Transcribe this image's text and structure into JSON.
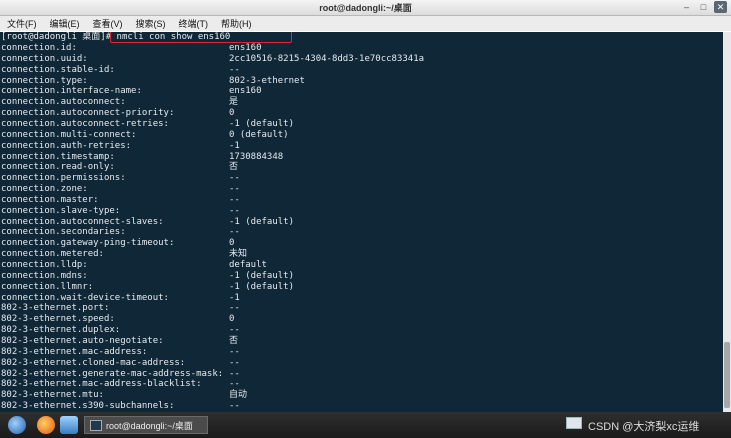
{
  "window": {
    "title": "root@dadongli:~/桌面"
  },
  "menu": [
    "文件(F)",
    "编辑(E)",
    "查看(V)",
    "搜索(S)",
    "终端(T)",
    "帮助(H)"
  ],
  "terminal": {
    "prompt": "[root@dadongli 桌面]# ",
    "command": "nmcli con show ens160",
    "rows": [
      {
        "key": "connection.id:",
        "val": "ens160"
      },
      {
        "key": "connection.uuid:",
        "val": "2cc10516-8215-4304-8dd3-1e70cc83341a"
      },
      {
        "key": "connection.stable-id:",
        "val": "--"
      },
      {
        "key": "connection.type:",
        "val": "802-3-ethernet"
      },
      {
        "key": "connection.interface-name:",
        "val": "ens160"
      },
      {
        "key": "connection.autoconnect:",
        "val": "是"
      },
      {
        "key": "connection.autoconnect-priority:",
        "val": "0"
      },
      {
        "key": "connection.autoconnect-retries:",
        "val": "-1 (default)"
      },
      {
        "key": "connection.multi-connect:",
        "val": "0 (default)"
      },
      {
        "key": "connection.auth-retries:",
        "val": "-1"
      },
      {
        "key": "connection.timestamp:",
        "val": "1730884348"
      },
      {
        "key": "connection.read-only:",
        "val": "否"
      },
      {
        "key": "connection.permissions:",
        "val": "--"
      },
      {
        "key": "connection.zone:",
        "val": "--"
      },
      {
        "key": "connection.master:",
        "val": "--"
      },
      {
        "key": "connection.slave-type:",
        "val": "--"
      },
      {
        "key": "connection.autoconnect-slaves:",
        "val": "-1 (default)"
      },
      {
        "key": "connection.secondaries:",
        "val": "--"
      },
      {
        "key": "connection.gateway-ping-timeout:",
        "val": "0"
      },
      {
        "key": "connection.metered:",
        "val": "未知"
      },
      {
        "key": "connection.lldp:",
        "val": "default"
      },
      {
        "key": "connection.mdns:",
        "val": "-1 (default)"
      },
      {
        "key": "connection.llmnr:",
        "val": "-1 (default)"
      },
      {
        "key": "connection.wait-device-timeout:",
        "val": "-1"
      },
      {
        "key": "802-3-ethernet.port:",
        "val": "--"
      },
      {
        "key": "802-3-ethernet.speed:",
        "val": "0"
      },
      {
        "key": "802-3-ethernet.duplex:",
        "val": "--"
      },
      {
        "key": "802-3-ethernet.auto-negotiate:",
        "val": "否"
      },
      {
        "key": "802-3-ethernet.mac-address:",
        "val": "--"
      },
      {
        "key": "802-3-ethernet.cloned-mac-address:",
        "val": "--"
      },
      {
        "key": "802-3-ethernet.generate-mac-address-mask:",
        "val": "--"
      },
      {
        "key": "802-3-ethernet.mac-address-blacklist:",
        "val": "--"
      },
      {
        "key": "802-3-ethernet.mtu:",
        "val": "自动"
      },
      {
        "key": "802-3-ethernet.s390-subchannels:",
        "val": "--"
      }
    ]
  },
  "taskbar": {
    "task_label": "root@dadongli:~/桌面"
  },
  "watermark": "CSDN @大济梨xc运维"
}
